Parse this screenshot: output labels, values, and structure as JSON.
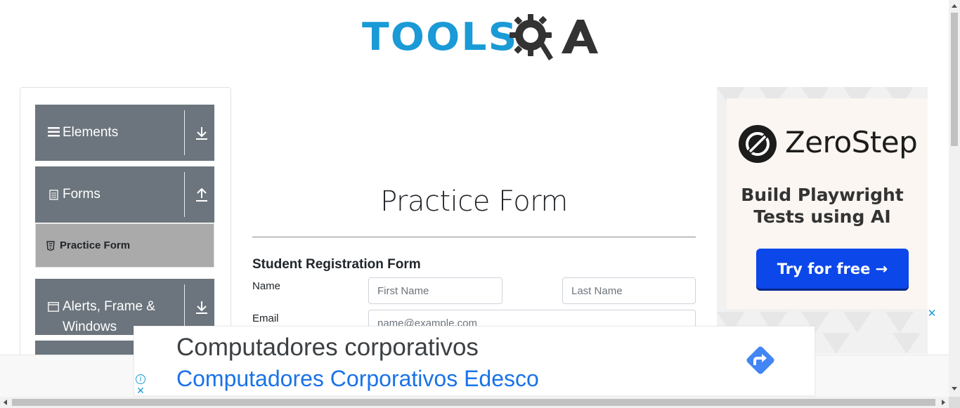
{
  "logo": {
    "text_tools": "TOOLS",
    "text_qa": "QA",
    "colors": {
      "tools": "#1a9ad6",
      "qa": "#333333"
    }
  },
  "sidebar": {
    "groups": [
      {
        "label": "Elements",
        "icon": "hamburger-icon",
        "arrow": "download-arrow-icon"
      },
      {
        "label": "Forms",
        "icon": "document-icon",
        "arrow": "upload-arrow-icon",
        "items": [
          {
            "label": "Practice Form",
            "icon": "html5-icon",
            "active": true
          }
        ]
      },
      {
        "label": "Alerts, Frame & Windows",
        "icon": "window-icon",
        "arrow": "download-arrow-icon"
      }
    ],
    "colors": {
      "group_bg": "#6c757d",
      "active_item_bg": "#aaaaaa"
    }
  },
  "main": {
    "title": "Practice Form",
    "form_title": "Student Registration Form",
    "name_label": "Name",
    "first_name_placeholder": "First Name",
    "last_name_placeholder": "Last Name",
    "email_label": "Email",
    "email_placeholder": "name@example.com"
  },
  "right_ad": {
    "brand": "ZeroStep",
    "tagline_line1": "Build Playwright",
    "tagline_line2": "Tests using AI",
    "cta": "Try for free →",
    "close": "✕",
    "colors": {
      "cta_bg": "#0c47e9"
    }
  },
  "bottom_ad": {
    "headline": "Computadores corporativos",
    "subline": "Computadores Corporativos Edesco",
    "info": "i",
    "close": "✕",
    "icon": "directions-arrow-icon",
    "colors": {
      "subline": "#1a73e8",
      "arrow": "#4285f4"
    }
  }
}
